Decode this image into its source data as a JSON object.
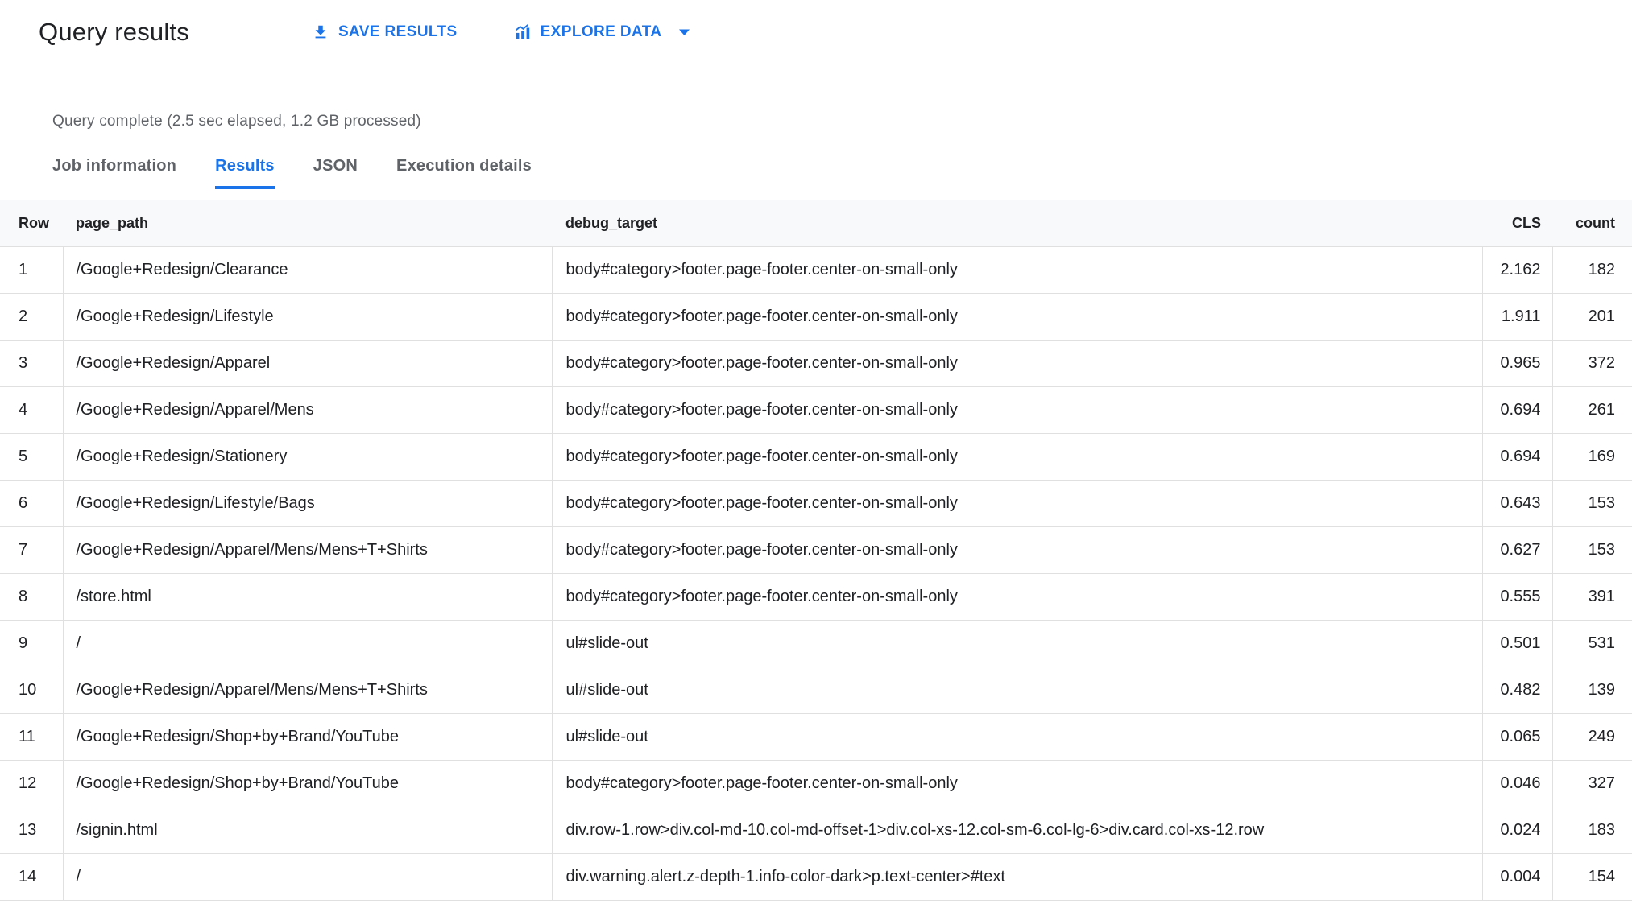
{
  "header": {
    "title": "Query results",
    "save_button": "SAVE RESULTS",
    "explore_button": "EXPLORE DATA"
  },
  "status": "Query complete (2.5 sec elapsed, 1.2 GB processed)",
  "tabs": [
    {
      "label": "Job information",
      "active": false
    },
    {
      "label": "Results",
      "active": true
    },
    {
      "label": "JSON",
      "active": false
    },
    {
      "label": "Execution details",
      "active": false
    }
  ],
  "colors": {
    "accent": "#1a73e8",
    "text": "#202124",
    "secondary_text": "#5f6368",
    "border": "#e0e0e0",
    "header_bg": "#f8f9fa"
  },
  "icons": {
    "save": "download-icon",
    "explore": "bar-chart-trend-icon",
    "caret": "dropdown-caret-icon"
  },
  "table": {
    "columns": [
      "Row",
      "page_path",
      "debug_target",
      "CLS",
      "count"
    ],
    "rows": [
      {
        "row": "1",
        "page_path": "/Google+Redesign/Clearance",
        "debug_target": "body#category>footer.page-footer.center-on-small-only",
        "cls": "2.162",
        "count": "182"
      },
      {
        "row": "2",
        "page_path": "/Google+Redesign/Lifestyle",
        "debug_target": "body#category>footer.page-footer.center-on-small-only",
        "cls": "1.911",
        "count": "201"
      },
      {
        "row": "3",
        "page_path": "/Google+Redesign/Apparel",
        "debug_target": "body#category>footer.page-footer.center-on-small-only",
        "cls": "0.965",
        "count": "372"
      },
      {
        "row": "4",
        "page_path": "/Google+Redesign/Apparel/Mens",
        "debug_target": "body#category>footer.page-footer.center-on-small-only",
        "cls": "0.694",
        "count": "261"
      },
      {
        "row": "5",
        "page_path": "/Google+Redesign/Stationery",
        "debug_target": "body#category>footer.page-footer.center-on-small-only",
        "cls": "0.694",
        "count": "169"
      },
      {
        "row": "6",
        "page_path": "/Google+Redesign/Lifestyle/Bags",
        "debug_target": "body#category>footer.page-footer.center-on-small-only",
        "cls": "0.643",
        "count": "153"
      },
      {
        "row": "7",
        "page_path": "/Google+Redesign/Apparel/Mens/Mens+T+Shirts",
        "debug_target": "body#category>footer.page-footer.center-on-small-only",
        "cls": "0.627",
        "count": "153"
      },
      {
        "row": "8",
        "page_path": "/store.html",
        "debug_target": "body#category>footer.page-footer.center-on-small-only",
        "cls": "0.555",
        "count": "391"
      },
      {
        "row": "9",
        "page_path": "/",
        "debug_target": "ul#slide-out",
        "cls": "0.501",
        "count": "531"
      },
      {
        "row": "10",
        "page_path": "/Google+Redesign/Apparel/Mens/Mens+T+Shirts",
        "debug_target": "ul#slide-out",
        "cls": "0.482",
        "count": "139"
      },
      {
        "row": "11",
        "page_path": "/Google+Redesign/Shop+by+Brand/YouTube",
        "debug_target": "ul#slide-out",
        "cls": "0.065",
        "count": "249"
      },
      {
        "row": "12",
        "page_path": "/Google+Redesign/Shop+by+Brand/YouTube",
        "debug_target": "body#category>footer.page-footer.center-on-small-only",
        "cls": "0.046",
        "count": "327"
      },
      {
        "row": "13",
        "page_path": "/signin.html",
        "debug_target": "div.row-1.row>div.col-md-10.col-md-offset-1>div.col-xs-12.col-sm-6.col-lg-6>div.card.col-xs-12.row",
        "cls": "0.024",
        "count": "183"
      },
      {
        "row": "14",
        "page_path": "/",
        "debug_target": "div.warning.alert.z-depth-1.info-color-dark>p.text-center>#text",
        "cls": "0.004",
        "count": "154"
      }
    ]
  }
}
